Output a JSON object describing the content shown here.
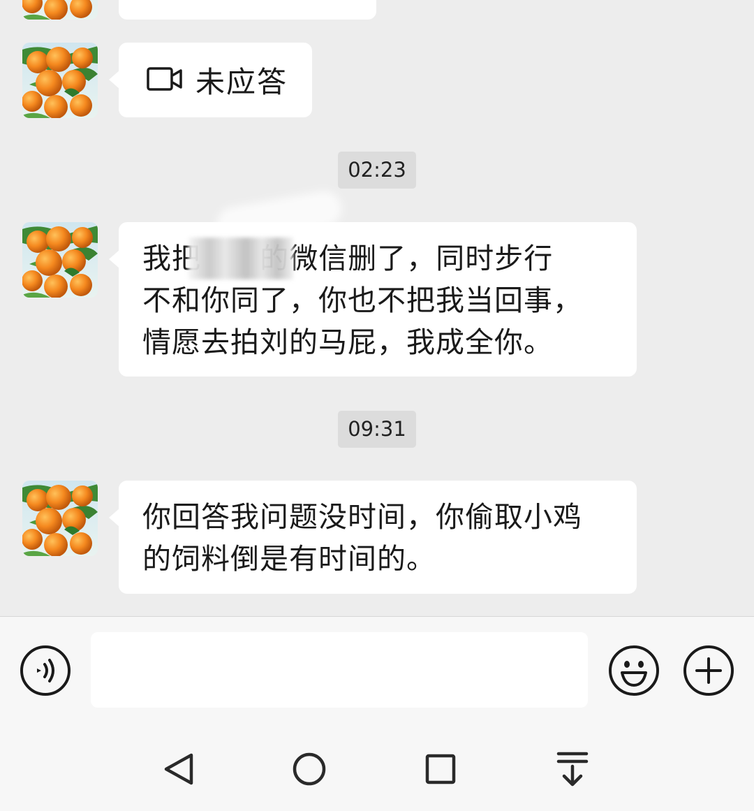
{
  "messages": {
    "call": {
      "label": "未应答",
      "icon": "video-call-icon"
    },
    "time_1": "02:23",
    "message_1": "我把      的微信删了，同时步行\n不和你同了，你也不把我当回事，\n情愿去拍刘的马屁，我成全你。",
    "time_2": "09:31",
    "message_2": "你回答我问题没时间，你偷取小鸡\n的饲料倒是有时间的。"
  },
  "input": {
    "value": "",
    "placeholder": ""
  },
  "icons": {
    "voice": "voice-input-icon",
    "emoji": "emoji-icon",
    "more": "plus-icon",
    "nav_back": "back-triangle-icon",
    "nav_home": "home-circle-icon",
    "nav_recent": "recent-square-icon",
    "nav_menu": "menu-down-icon"
  },
  "colors": {
    "chat_bg": "#ededed",
    "bubble": "#ffffff",
    "time_badge": "#dcdcdc",
    "bar": "#f7f7f7"
  }
}
